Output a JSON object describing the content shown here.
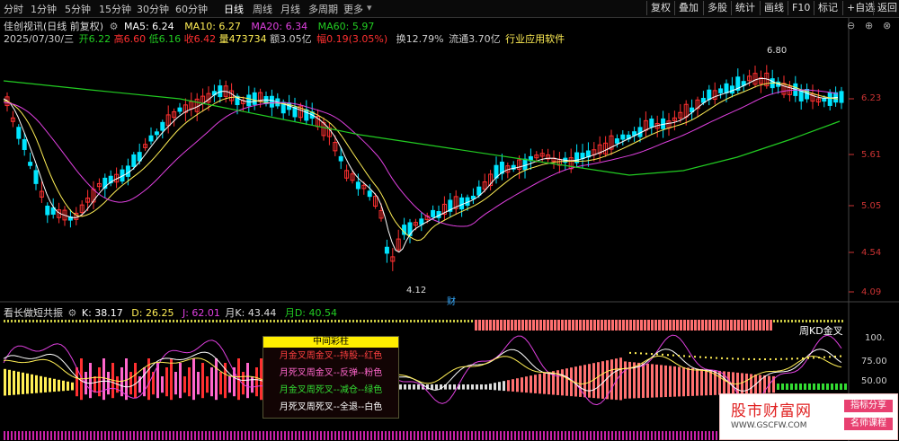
{
  "toolbar": {
    "timeframes": [
      "分时",
      "1分钟",
      "5分钟",
      "15分钟",
      "30分钟",
      "60分钟",
      "日线",
      "周线",
      "月线",
      "多周期",
      "更多"
    ],
    "active": "日线",
    "right_buttons": [
      "复权",
      "叠加",
      "多股",
      "统计",
      "画线",
      "F10",
      "标记",
      "+自选",
      "返回"
    ]
  },
  "header": {
    "stock": "佳创视讯(日线 前复权)",
    "ma5": "MA5: 6.24",
    "ma10": "MA10: 6.27",
    "ma20": "MA20: 6.34",
    "ma60": "MA60: 5.97",
    "date": "2025/07/30/三",
    "open": "开6.22",
    "high": "高6.60",
    "low": "低6.16",
    "close": "收6.42",
    "vol": "量473734",
    "amount": "额3.05亿",
    "change": "幅0.19(3.05%)",
    "turnover": "换12.79%",
    "float": "流通3.70亿",
    "industry": "行业应用软件"
  },
  "price_axis": [
    "6.23",
    "5.61",
    "5.05",
    "4.54",
    "4.09"
  ],
  "annotations": {
    "high": "6.80",
    "low": "4.12",
    "marker": "财"
  },
  "indicator": {
    "name": "看长做短共振",
    "k": "K: 38.17",
    "d": "D: 26.25",
    "j": "J: 62.01",
    "mk": "月K: 43.44",
    "md": "月D: 40.54",
    "label": "周KD金叉",
    "axis": [
      "100.",
      "75.00",
      "50.00"
    ]
  },
  "legend": {
    "title": "中间彩柱",
    "rows": [
      {
        "text": "月金叉周金叉--持股--红色",
        "color": "#ff4040"
      },
      {
        "text": "月死叉周金叉--反弹--粉色",
        "color": "#ff66cc"
      },
      {
        "text": "月金叉周死叉--减仓--绿色",
        "color": "#33dd33"
      },
      {
        "text": "月死叉周死叉--全退--白色",
        "color": "#ffffff"
      }
    ]
  },
  "watermark": {
    "title": "股市财富网",
    "url": "WWW.GSCFW.COM",
    "tag1": "指标分享",
    "tag2": "名师课程"
  },
  "colors": {
    "up": "#ff3030",
    "down": "#00e5ff",
    "ma5": "#ffffff",
    "ma10": "#ffee55",
    "ma20": "#e040e0",
    "ma60": "#22cc22"
  }
}
